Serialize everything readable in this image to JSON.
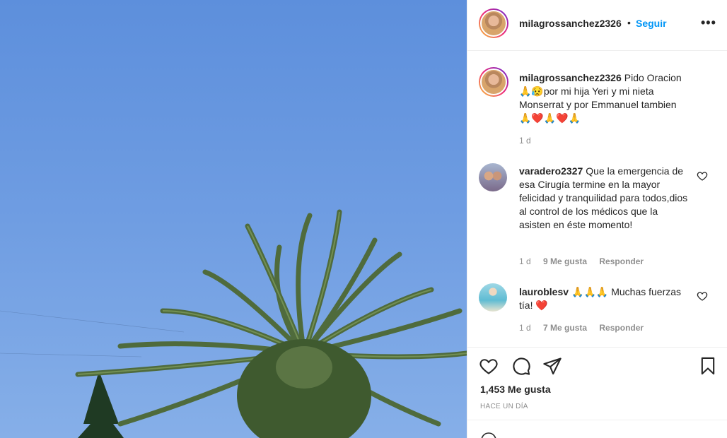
{
  "post": {
    "username": "milagrossanchez2326",
    "dot": "•",
    "follow_label": "Seguir",
    "more_label": "•••"
  },
  "caption": {
    "username": "milagrossanchez2326",
    "text": "Pido Oracion🙏😥por mi hija Yeri y mi nieta Monserrat y por Emmanuel tambien 🙏❤️🙏❤️🙏",
    "time": "1 d"
  },
  "comments": [
    {
      "username": "varadero2327",
      "text": "Que la emergencia de esa Cirugía termine en la mayor felicidad y tranquilidad para todos,dios al control de los médicos que la asisten en éste momento!",
      "time": "1 d",
      "likes": "9 Me gusta",
      "reply": "Responder"
    },
    {
      "username": "lauroblesv",
      "text": "🙏🙏🙏 Muchas fuerzas tía! ❤️",
      "time": "1 d",
      "likes": "7 Me gusta",
      "reply": "Responder"
    }
  ],
  "footer": {
    "likes": "1,453 Me gusta",
    "time": "Hace un día"
  },
  "icons": {
    "like": "heart-icon",
    "comment": "comment-icon",
    "share": "paper-plane-icon",
    "save": "bookmark-icon",
    "more": "more-icon"
  },
  "colors": {
    "accent": "#0095f6",
    "text": "#262626",
    "muted": "#8e8e8e",
    "sky": "#6a9ae0",
    "divider": "#efefef"
  }
}
